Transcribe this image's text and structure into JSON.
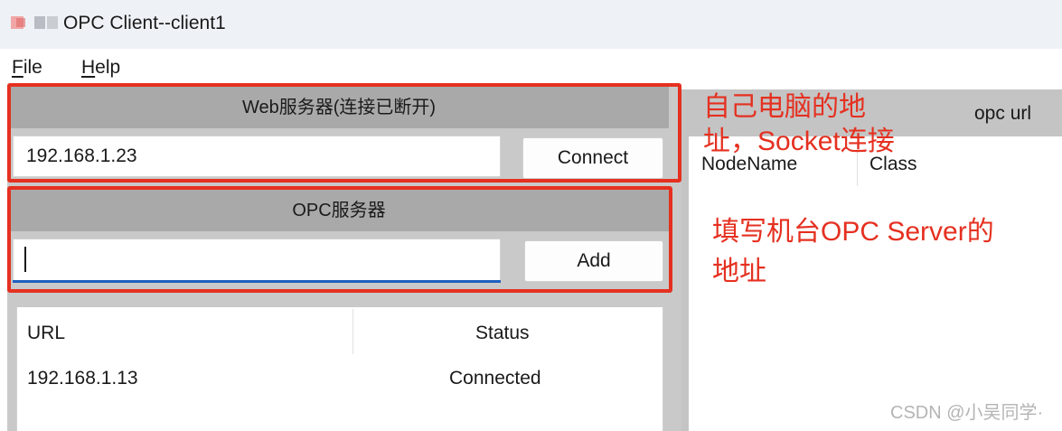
{
  "window": {
    "title": "OPC Client--client1"
  },
  "menu": {
    "file_accel": "F",
    "file_rest": "ile",
    "help_accel": "H",
    "help_rest": "elp"
  },
  "web_server": {
    "header": "Web服务器(连接已断开)",
    "address_value": "192.168.1.23",
    "connect_label": "Connect"
  },
  "opc_server": {
    "header": "OPC服务器",
    "address_value": "",
    "add_label": "Add"
  },
  "server_table": {
    "columns": [
      "URL",
      "Status"
    ],
    "rows": [
      {
        "url": "192.168.1.13",
        "status": "Connected"
      }
    ]
  },
  "right_panel": {
    "url_label": "opc url",
    "columns": [
      "NodeName",
      "Class"
    ]
  },
  "annotations": {
    "web_note_line1": "自己电脑的地",
    "web_note_line2": "址，Socket连接",
    "opc_note_line1": "填写机台OPC Server的",
    "opc_note_line2": "地址"
  },
  "watermark": "CSDN @小吴同学·",
  "colors": {
    "annotation_red": "#e53020",
    "section_gray": "#a9a9a9",
    "focus_blue": "#1f5fbf"
  }
}
